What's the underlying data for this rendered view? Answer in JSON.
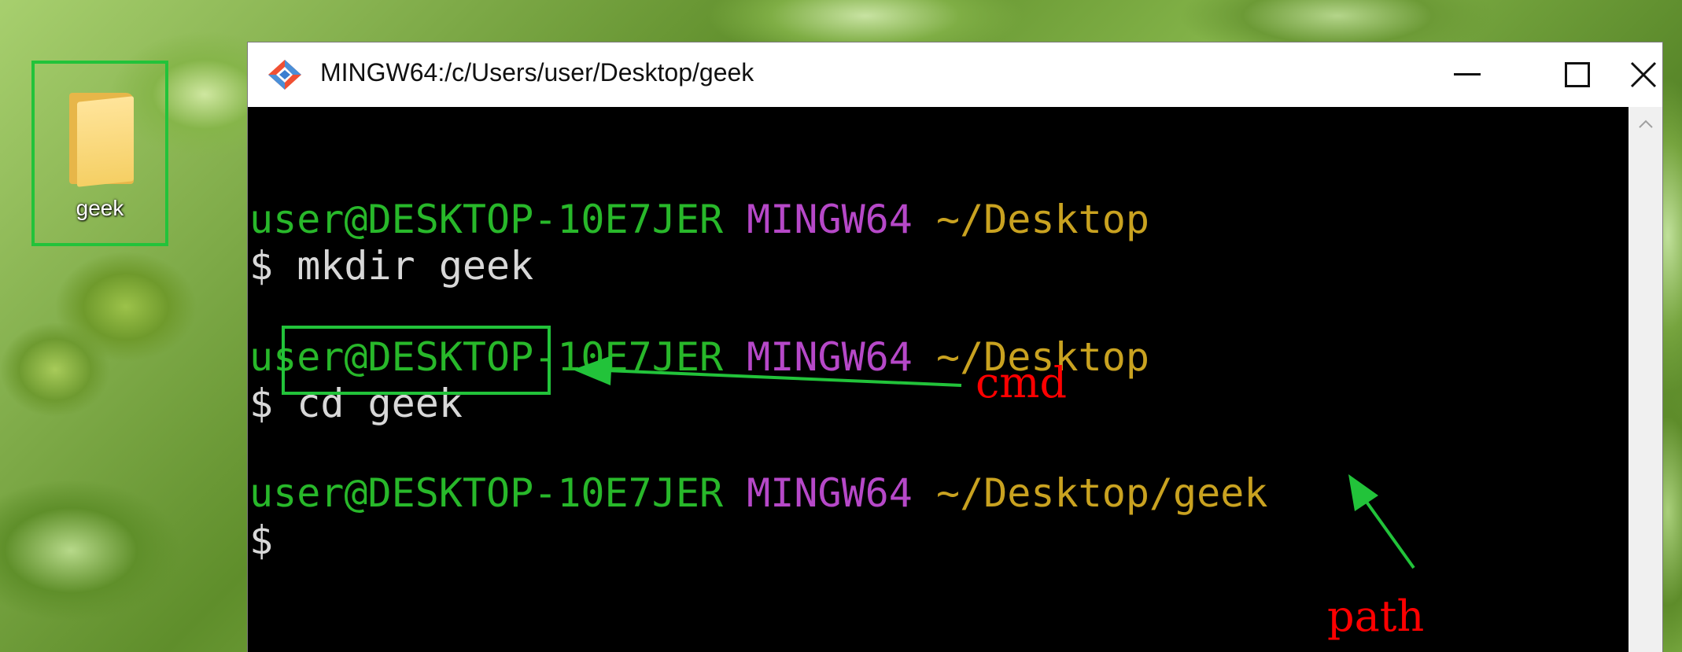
{
  "desktop": {
    "icon_label": "geek"
  },
  "window": {
    "title": "MINGW64:/c/Users/user/Desktop/geek",
    "buttons": [
      "minimize-icon",
      "maximize-icon",
      "close-icon"
    ]
  },
  "terminal": {
    "blocks": [
      {
        "user": "user@DESKTOP-10E7JER",
        "env": "MINGW64",
        "path": "~/Desktop",
        "command": "$ mkdir geek"
      },
      {
        "user": "user@DESKTOP-10E7JER",
        "env": "MINGW64",
        "path": "~/Desktop",
        "prompt": "$",
        "command": "cd geek"
      },
      {
        "user": "user@DESKTOP-10E7JER",
        "env": "MINGW64",
        "path": "~/Desktop/geek",
        "command": "$"
      }
    ],
    "colors": {
      "user": "#28b82a",
      "env": "#b648c8",
      "path": "#c9a220",
      "command": "#d8d8d8"
    }
  },
  "annotations": {
    "cmd_label": "cmd",
    "path_label": "path",
    "highlight_color": "#22c33a",
    "label_color": "#ff0000"
  }
}
